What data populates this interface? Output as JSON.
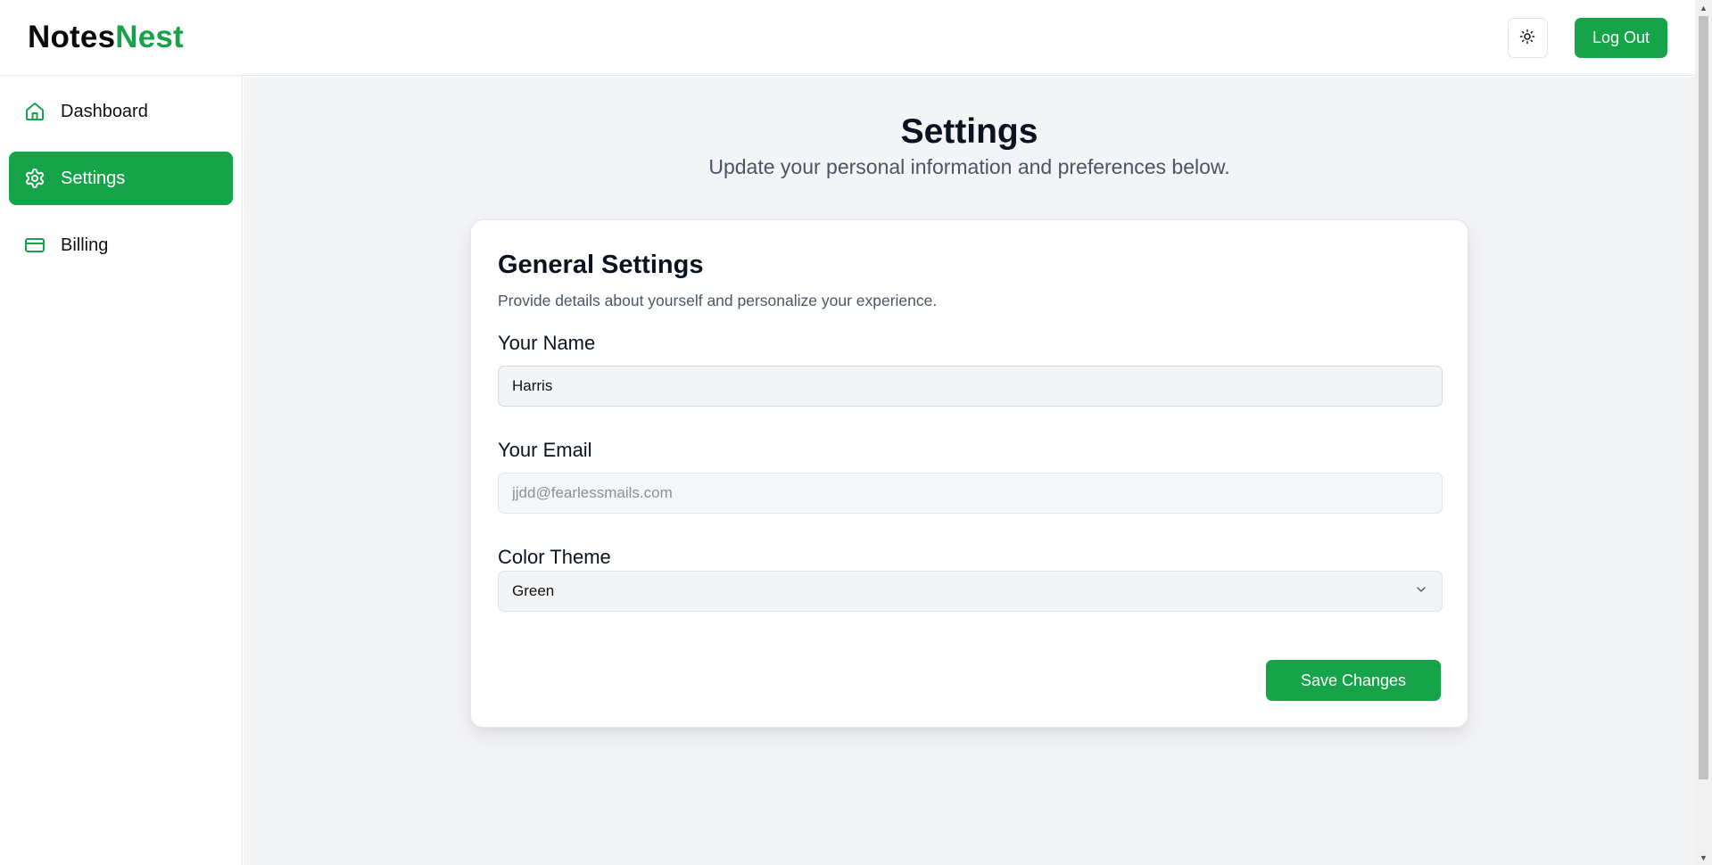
{
  "header": {
    "logo_part1": "Notes",
    "logo_part2": "Nest",
    "theme_toggle_icon": "sun-icon",
    "logout_label": "Log Out"
  },
  "sidebar": {
    "items": [
      {
        "label": "Dashboard",
        "icon": "home-icon",
        "active": false
      },
      {
        "label": "Settings",
        "icon": "gear-icon",
        "active": true
      },
      {
        "label": "Billing",
        "icon": "credit-card-icon",
        "active": false
      }
    ]
  },
  "main": {
    "title": "Settings",
    "subtitle": "Update your personal information and preferences below."
  },
  "card": {
    "title": "General Settings",
    "description": "Provide details about yourself and personalize your experience.",
    "name_label": "Your Name",
    "name_value": "Harris",
    "email_label": "Your Email",
    "email_placeholder": "jjdd@fearlessmails.com",
    "theme_label": "Color Theme",
    "theme_value": "Green",
    "save_label": "Save Changes"
  },
  "colors": {
    "accent": "#16a34a",
    "main_bg": "#f3f4f6"
  }
}
